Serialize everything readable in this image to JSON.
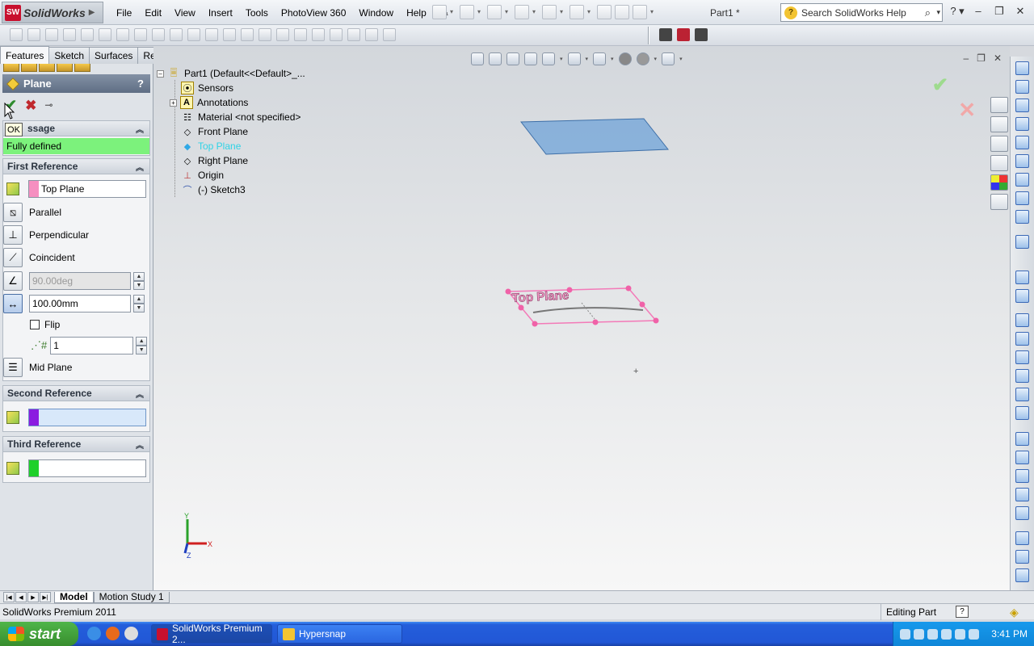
{
  "app": {
    "brand": "SolidWorks",
    "logo_letters": "SW",
    "document_title": "Part1 *",
    "menu": [
      "File",
      "Edit",
      "View",
      "Insert",
      "Tools",
      "PhotoView 360",
      "Window",
      "Help"
    ],
    "search_placeholder": "Search SolidWorks Help"
  },
  "command_tabs": [
    "Features",
    "Sketch",
    "Surfaces",
    "Render Tools"
  ],
  "property_manager": {
    "title": "Plane",
    "help": "?",
    "tooltip": "OK",
    "message": {
      "header": "Message",
      "header_visible": "ssage",
      "text": "Fully defined",
      "color": "#7cf27c"
    },
    "first_reference": {
      "header": "First Reference",
      "selection": "Top Plane",
      "swatch_color": "#f68fc0",
      "options": [
        "Parallel",
        "Perpendicular",
        "Coincident"
      ],
      "angle_value": "90.00deg",
      "distance_value": "100.00mm",
      "flip_label": "Flip",
      "flip_checked": false,
      "instances_value": "1",
      "mid_plane_label": "Mid Plane"
    },
    "second_reference": {
      "header": "Second Reference",
      "selection": "",
      "swatch_color": "#8b1ce0"
    },
    "third_reference": {
      "header": "Third Reference",
      "selection": "",
      "swatch_color": "#1ed02a"
    }
  },
  "feature_tree": {
    "root": "Part1  (Default<<Default>_...",
    "items": [
      {
        "label": "Sensors",
        "icon": "sensors-icon"
      },
      {
        "label": "Annotations",
        "icon": "annotations-icon",
        "expandable": true
      },
      {
        "label": "Material <not specified>",
        "icon": "material-icon"
      },
      {
        "label": "Front Plane",
        "icon": "plane-icon"
      },
      {
        "label": "Top Plane",
        "icon": "plane-icon",
        "highlighted": true
      },
      {
        "label": "Right Plane",
        "icon": "plane-icon"
      },
      {
        "label": "Origin",
        "icon": "origin-icon"
      },
      {
        "label": "(-) Sketch3",
        "icon": "sketch-icon"
      }
    ]
  },
  "viewport": {
    "preview_plane_label": "Top Plane",
    "preview_color": "#f37ab8",
    "new_plane_color": "#6fa3d8",
    "triad_labels": {
      "x": "X",
      "y": "Y",
      "z": "Z"
    }
  },
  "bottom_tabs": [
    "Model",
    "Motion Study 1"
  ],
  "status": {
    "product": "SolidWorks Premium 2011",
    "mode": "Editing Part",
    "help": "?"
  },
  "taskbar": {
    "start_label": "start",
    "windows": [
      "SolidWorks Premium 2...",
      "Hypersnap"
    ],
    "clock": "3:41 PM"
  }
}
